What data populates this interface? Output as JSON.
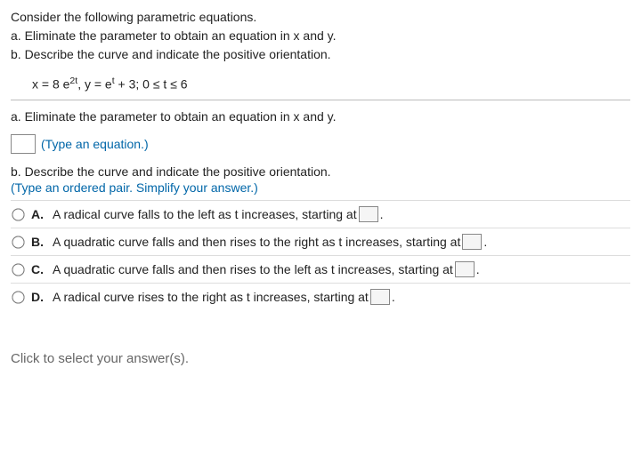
{
  "prompt": {
    "intro": "Consider the following parametric equations.",
    "part_a": "a. Eliminate the parameter to obtain an equation in x and y.",
    "part_b": "b. Describe the curve and indicate the positive orientation."
  },
  "equation": {
    "x_lhs": "x = 8 e",
    "x_exp": "2t",
    "sep": ", ",
    "y_lhs": "y = e",
    "y_exp": "t",
    "y_tail": " + 3; 0 ≤ t ≤ 6"
  },
  "section_a": {
    "label": "a. Eliminate the parameter to obtain an equation in x and y.",
    "hint": "(Type an equation.)"
  },
  "section_b": {
    "label": "b. Describe the curve and indicate the positive orientation.",
    "hint": "(Type an ordered pair. Simplify your answer.)"
  },
  "options": [
    {
      "letter": "A.",
      "text_before": "A radical curve falls to the left as t increases, starting at ",
      "text_after": "."
    },
    {
      "letter": "B.",
      "text_before": "A quadratic curve falls and then rises to the right as t increases, starting at ",
      "text_after": "."
    },
    {
      "letter": "C.",
      "text_before": "A quadratic curve falls and then rises to the left as t increases, starting at ",
      "text_after": "."
    },
    {
      "letter": "D.",
      "text_before": "A radical curve rises to the right as t increases, starting at ",
      "text_after": "."
    }
  ],
  "footer": "Click to select your answer(s)."
}
